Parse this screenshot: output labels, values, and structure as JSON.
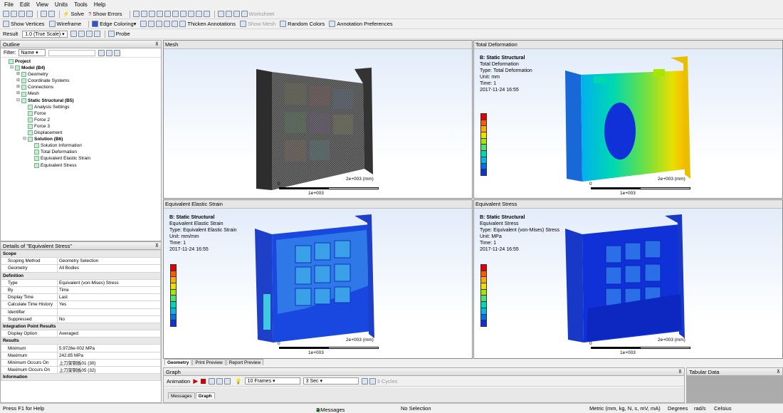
{
  "menu": [
    "File",
    "Edit",
    "View",
    "Units",
    "Tools",
    "Help"
  ],
  "toolbar1": {
    "solve": "Solve",
    "show_errors": "Show Errors",
    "worksheet": "Worksheet"
  },
  "toolbar2": {
    "show_vertices": "Show Vertices",
    "wireframe": "Wireframe",
    "edge_coloring": "Edge Coloring",
    "thicken": "Thicken Annotations",
    "show_mesh": "Show Mesh",
    "random_colors": "Random Colors",
    "annotation_prefs": "Annotation Preferences"
  },
  "toolbar3": {
    "result_label": "Result",
    "result_scale": "1.0 (True Scale)",
    "probe": "Probe"
  },
  "outline": {
    "title": "Outline",
    "filter_label": "Filter:",
    "filter_value": "Name",
    "tree": [
      {
        "label": "Project",
        "level": 0,
        "bold": true,
        "exp": ""
      },
      {
        "label": "Model (B4)",
        "level": 1,
        "bold": true,
        "exp": "⊟"
      },
      {
        "label": "Geometry",
        "level": 2,
        "bold": false,
        "exp": "⊞"
      },
      {
        "label": "Coordinate Systems",
        "level": 2,
        "bold": false,
        "exp": "⊞"
      },
      {
        "label": "Connections",
        "level": 2,
        "bold": false,
        "exp": "⊞"
      },
      {
        "label": "Mesh",
        "level": 2,
        "bold": false,
        "exp": "⊞"
      },
      {
        "label": "Static Structural (B5)",
        "level": 2,
        "bold": true,
        "exp": "⊟"
      },
      {
        "label": "Analysis Settings",
        "level": 3,
        "bold": false,
        "exp": ""
      },
      {
        "label": "Force",
        "level": 3,
        "bold": false,
        "exp": ""
      },
      {
        "label": "Force 2",
        "level": 3,
        "bold": false,
        "exp": ""
      },
      {
        "label": "Force 3",
        "level": 3,
        "bold": false,
        "exp": ""
      },
      {
        "label": "Displacement",
        "level": 3,
        "bold": false,
        "exp": ""
      },
      {
        "label": "Solution (B6)",
        "level": 3,
        "bold": true,
        "exp": "⊟"
      },
      {
        "label": "Solution Information",
        "level": 4,
        "bold": false,
        "exp": ""
      },
      {
        "label": "Total Deformation",
        "level": 4,
        "bold": false,
        "exp": ""
      },
      {
        "label": "Equivalent Elastic Strain",
        "level": 4,
        "bold": false,
        "exp": ""
      },
      {
        "label": "Equivalent Stress",
        "level": 4,
        "bold": false,
        "exp": ""
      }
    ]
  },
  "details": {
    "title": "Details of \"Equivalent Stress\"",
    "rows": [
      {
        "k": "Scope",
        "v": "",
        "sec": true
      },
      {
        "k": "Scoping Method",
        "v": "Geometry Selection",
        "sec": false
      },
      {
        "k": "Geometry",
        "v": "All Bodies",
        "sec": false
      },
      {
        "k": "Definition",
        "v": "",
        "sec": true
      },
      {
        "k": "Type",
        "v": "Equivalent (von-Mises) Stress",
        "sec": false
      },
      {
        "k": "By",
        "v": "Time",
        "sec": false
      },
      {
        "k": "Display Time",
        "v": "Last",
        "sec": false
      },
      {
        "k": "Calculate Time History",
        "v": "Yes",
        "sec": false
      },
      {
        "k": "Identifier",
        "v": "",
        "sec": false
      },
      {
        "k": "Suppressed",
        "v": "No",
        "sec": false
      },
      {
        "k": "Integration Point Results",
        "v": "",
        "sec": true
      },
      {
        "k": "Display Option",
        "v": "Averaged",
        "sec": false
      },
      {
        "k": "Results",
        "v": "",
        "sec": true
      },
      {
        "k": "Minimum",
        "v": "5.9726e-002 MPa",
        "sec": false
      },
      {
        "k": "Maximum",
        "v": "242.85 MPa",
        "sec": false
      },
      {
        "k": "Minimum Occurs On",
        "v": "上刀架铜板01 (30)",
        "sec": false
      },
      {
        "k": "Maximum Occurs On",
        "v": "上刀架铜板05 (32)",
        "sec": false
      },
      {
        "k": "Information",
        "v": "",
        "sec": true
      }
    ]
  },
  "viewports": {
    "mesh": {
      "title": "Mesh",
      "scale_left": "0",
      "scale_mid": "1e+003",
      "scale_right": "2e+003 (mm)"
    },
    "deform": {
      "title": "Total Deformation",
      "lines": [
        "B: Static Structural",
        "Total Deformation",
        "Type: Total Deformation",
        "Unit: mm",
        "Time: 1",
        "2017-11-24 16:55"
      ],
      "scale_left": "0",
      "scale_mid": "1e+003",
      "scale_right": "2e+003 (mm)"
    },
    "strain": {
      "title": "Equivalent Elastic Strain",
      "lines": [
        "B: Static Structural",
        "Equivalent Elastic Strain",
        "Type: Equivalent Elastic Strain",
        "Unit: mm/mm",
        "Time: 1",
        "2017-11-24 16:55"
      ],
      "scale_left": "0",
      "scale_mid": "1e+003",
      "scale_right": "2e+003 (mm)"
    },
    "stress": {
      "title": "Equivalent Stress",
      "lines": [
        "B: Static Structural",
        "Equivalent Stress",
        "Type: Equivalent (von-Mises) Stress",
        "Unit: MPa",
        "Time: 1",
        "2017-11-24 16:55"
      ],
      "scale_left": "0",
      "scale_mid": "1e+003",
      "scale_right": "2e+003 (mm)"
    }
  },
  "legend_colors": [
    "#e40000",
    "#ff5a00",
    "#ffaa00",
    "#e8e000",
    "#a8e600",
    "#50e070",
    "#00d8b0",
    "#00b8e8",
    "#0070f0",
    "#1030d8"
  ],
  "view_tabs": [
    "Geometry",
    "Print Preview",
    "Report Preview"
  ],
  "graph": {
    "title": "Graph",
    "animation": "Animation",
    "frames": "10 Frames",
    "secs": "3 Sec",
    "cycles": "3 Cycles",
    "tabs": [
      "Messages",
      "Graph"
    ]
  },
  "tabular": {
    "title": "Tabular Data"
  },
  "status": {
    "help": "Press F1 for Help",
    "messages": "2 Messages",
    "selection": "No Selection",
    "units": "Metric (mm, kg, N, s, mV, mA)",
    "degrees": "Degrees",
    "rads": "rad/s",
    "celsius": "Celsius"
  }
}
